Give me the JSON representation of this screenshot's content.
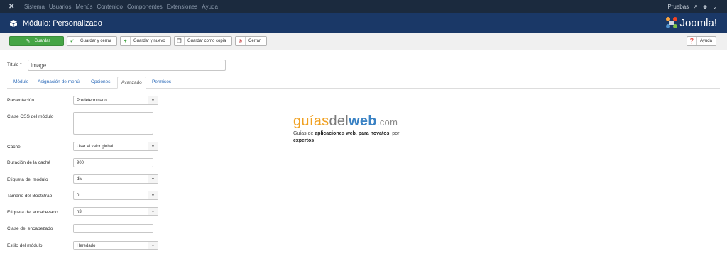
{
  "topbar": {
    "menu": [
      "Sistema",
      "Usuarios",
      "Menús",
      "Contenido",
      "Componentes",
      "Extensiones",
      "Ayuda"
    ],
    "site_link": "Pruebas"
  },
  "header": {
    "title": "Módulo: Personalizado",
    "brand": "Joomla!"
  },
  "toolbar": {
    "save": "Guardar",
    "save_close": "Guardar y cerrar",
    "save_new": "Guardar y nuevo",
    "save_copy": "Guardar como copia",
    "close": "Cerrar",
    "help": "Ayuda"
  },
  "form": {
    "title_label": "Título *",
    "title_value": "Image"
  },
  "tabs": [
    "Módulo",
    "Asignación de menú",
    "Opciones",
    "Avanzado",
    "Permisos"
  ],
  "active_tab": "Avanzado",
  "fields": {
    "layout_label": "Presentación",
    "layout_value": "Predeterminado",
    "css_label": "Clase CSS del módulo",
    "cache_label": "Caché",
    "cache_value": "Usar el valor global",
    "cache_time_label": "Duración de la caché",
    "cache_time_value": "900",
    "module_tag_label": "Etiqueta del módulo",
    "module_tag_value": "div",
    "bootstrap_label": "Tamaño del Bootstrap",
    "bootstrap_value": "0",
    "header_tag_label": "Etiqueta del encabezado",
    "header_tag_value": "h3",
    "header_class_label": "Clase del encabezado",
    "style_label": "Estilo del módulo",
    "style_value": "Heredado"
  },
  "watermark": {
    "logo_g": "guías",
    "logo_d": "del",
    "logo_w": "web",
    "logo_c": ".com",
    "tag_1": "Guías de ",
    "tag_2": "aplicaciones web",
    "tag_3": ", ",
    "tag_4": "para novatos",
    "tag_5": ", por",
    "tag_6": "expertos"
  }
}
